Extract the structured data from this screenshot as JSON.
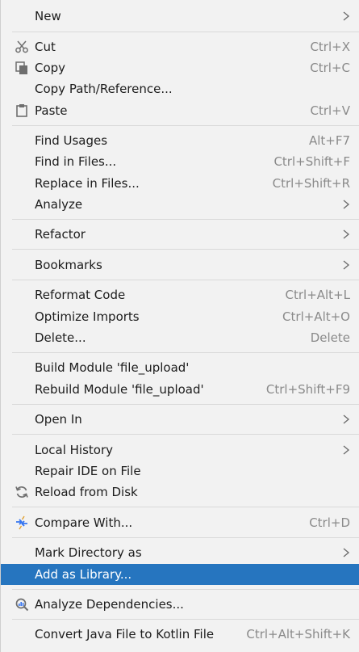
{
  "menu": {
    "items": [
      {
        "label": "New",
        "shortcut": "",
        "submenu": true,
        "icon": ""
      },
      {
        "label": "Cut",
        "shortcut": "Ctrl+X",
        "submenu": false,
        "icon": "scissors-icon"
      },
      {
        "label": "Copy",
        "shortcut": "Ctrl+C",
        "submenu": false,
        "icon": "copy-icon"
      },
      {
        "label": "Copy Path/Reference...",
        "shortcut": "",
        "submenu": false,
        "icon": ""
      },
      {
        "label": "Paste",
        "shortcut": "Ctrl+V",
        "submenu": false,
        "icon": "paste-icon"
      },
      {
        "label": "Find Usages",
        "shortcut": "Alt+F7",
        "submenu": false,
        "icon": ""
      },
      {
        "label": "Find in Files...",
        "shortcut": "Ctrl+Shift+F",
        "submenu": false,
        "icon": ""
      },
      {
        "label": "Replace in Files...",
        "shortcut": "Ctrl+Shift+R",
        "submenu": false,
        "icon": ""
      },
      {
        "label": "Analyze",
        "shortcut": "",
        "submenu": true,
        "icon": ""
      },
      {
        "label": "Refactor",
        "shortcut": "",
        "submenu": true,
        "icon": ""
      },
      {
        "label": "Bookmarks",
        "shortcut": "",
        "submenu": true,
        "icon": ""
      },
      {
        "label": "Reformat Code",
        "shortcut": "Ctrl+Alt+L",
        "submenu": false,
        "icon": ""
      },
      {
        "label": "Optimize Imports",
        "shortcut": "Ctrl+Alt+O",
        "submenu": false,
        "icon": ""
      },
      {
        "label": "Delete...",
        "shortcut": "Delete",
        "submenu": false,
        "icon": ""
      },
      {
        "label": "Build Module 'file_upload'",
        "shortcut": "",
        "submenu": false,
        "icon": ""
      },
      {
        "label": "Rebuild Module 'file_upload'",
        "shortcut": "Ctrl+Shift+F9",
        "submenu": false,
        "icon": ""
      },
      {
        "label": "Open In",
        "shortcut": "",
        "submenu": true,
        "icon": ""
      },
      {
        "label": "Local History",
        "shortcut": "",
        "submenu": true,
        "icon": ""
      },
      {
        "label": "Repair IDE on File",
        "shortcut": "",
        "submenu": false,
        "icon": ""
      },
      {
        "label": "Reload from Disk",
        "shortcut": "",
        "submenu": false,
        "icon": "reload-icon"
      },
      {
        "label": "Compare With...",
        "shortcut": "Ctrl+D",
        "submenu": false,
        "icon": "compare-icon"
      },
      {
        "label": "Mark Directory as",
        "shortcut": "",
        "submenu": true,
        "icon": ""
      },
      {
        "label": "Add as Library...",
        "shortcut": "",
        "submenu": false,
        "icon": "",
        "selected": true
      },
      {
        "label": "Analyze Dependencies...",
        "shortcut": "",
        "submenu": false,
        "icon": "analyze-dependencies-icon"
      },
      {
        "label": "Convert Java File to Kotlin File",
        "shortcut": "Ctrl+Alt+Shift+K",
        "submenu": false,
        "icon": ""
      }
    ]
  },
  "colors": {
    "background": "#f2f2f2",
    "selection": "#2675bf",
    "shortcut_text": "#8a8a8a",
    "separator": "#d9d9d9",
    "accent_icon": "#3574f0"
  }
}
